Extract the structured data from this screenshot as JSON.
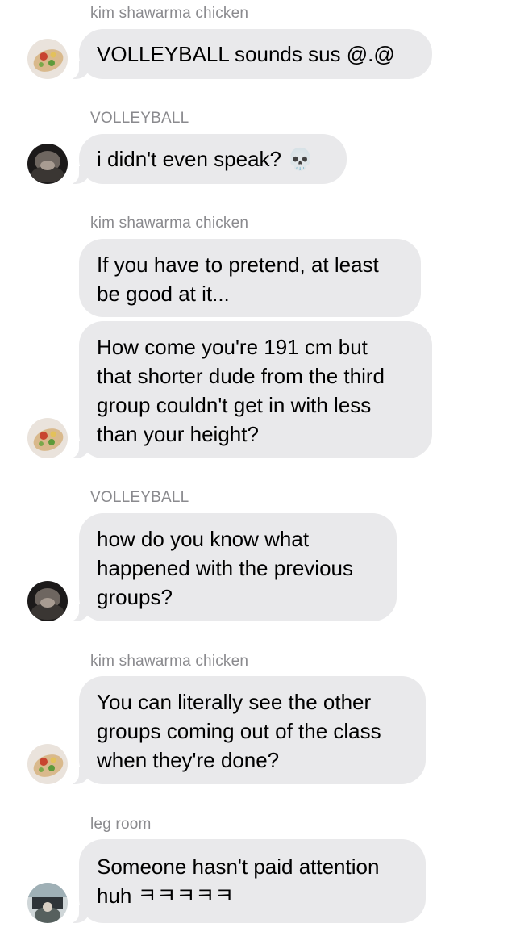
{
  "messages": [
    {
      "sender": "kim shawarma chicken",
      "lines": [
        "VOLLEYBALL sounds sus @.@"
      ]
    },
    {
      "sender": "VOLLEYBALL",
      "lines": [
        "i didn't even speak? 💀"
      ]
    },
    {
      "sender": "kim shawarma chicken",
      "lines": [
        "If you have to pretend, at least",
        "be good at it..."
      ]
    },
    {
      "lines": [
        "How come you're 191 cm but",
        "that shorter dude from the third",
        "group couldn't get in with less",
        "than your height?"
      ]
    },
    {
      "sender": "VOLLEYBALL",
      "lines": [
        "how do you know what",
        "happened with the previous",
        "groups?"
      ]
    },
    {
      "sender": "kim shawarma chicken",
      "lines": [
        "You can literally see the other",
        "groups coming out of the class",
        "when they're done?"
      ]
    },
    {
      "sender": "leg room",
      "lines": [
        "Someone hasn't paid attention",
        "huh ㅋㅋㅋㅋㅋ"
      ]
    }
  ],
  "avatars": {
    "kim": "shawarma-wrap-avatar",
    "volleyball": "dark-portrait-avatar",
    "legroom": "outdoor-photo-avatar"
  }
}
